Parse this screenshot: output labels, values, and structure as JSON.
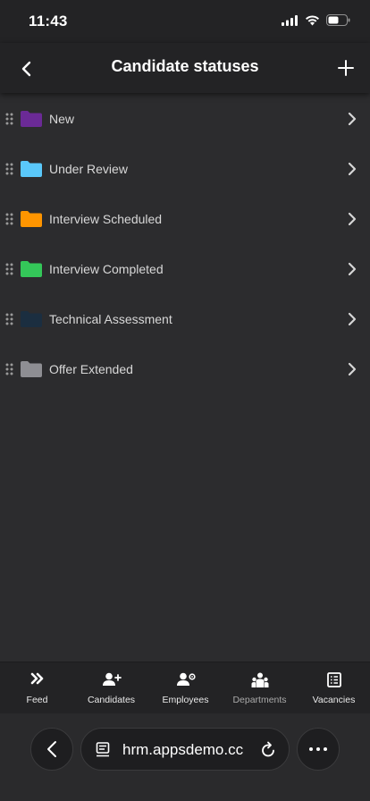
{
  "status_bar": {
    "time": "11:43"
  },
  "header": {
    "title": "Candidate statuses"
  },
  "statuses": [
    {
      "label": "New",
      "color": "#6b2a96"
    },
    {
      "label": "Under Review",
      "color": "#5ac8fa"
    },
    {
      "label": "Interview Scheduled",
      "color": "#ff9500"
    },
    {
      "label": "Interview Completed",
      "color": "#34c759"
    },
    {
      "label": "Technical Assessment",
      "color": "#1b2e40"
    },
    {
      "label": "Offer Extended",
      "color": "#8e8e93"
    }
  ],
  "tabbar": {
    "feed": "Feed",
    "candidates": "Candidates",
    "employees": "Employees",
    "departments": "Departments",
    "vacancies": "Vacancies"
  },
  "browser": {
    "url": "hrm.appsdemo.cc"
  },
  "icons": {
    "back": "chevron-left-icon",
    "add": "plus-icon",
    "drag": "drag-handle-icon",
    "folder": "folder-icon",
    "chevron": "chevron-right-icon"
  }
}
